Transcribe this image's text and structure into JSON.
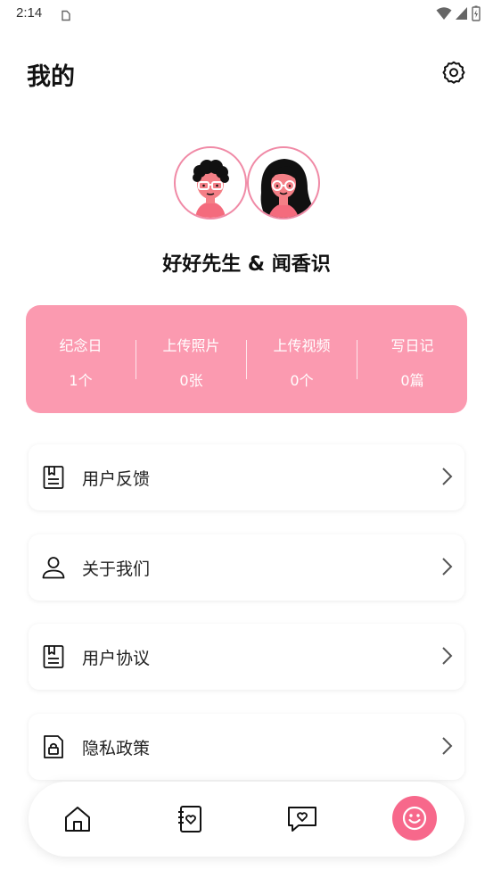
{
  "status_bar": {
    "time": "2:14"
  },
  "header": {
    "title": "我的"
  },
  "profile": {
    "couple_name": "好好先生 & 闻香识"
  },
  "stats": [
    {
      "label": "纪念日",
      "value": "1个"
    },
    {
      "label": "上传照片",
      "value": "0张"
    },
    {
      "label": "上传视频",
      "value": "0个"
    },
    {
      "label": "写日记",
      "value": "0篇"
    }
  ],
  "menu": [
    {
      "label": "用户反馈",
      "icon": "feedback-icon"
    },
    {
      "label": "关于我们",
      "icon": "user-icon"
    },
    {
      "label": "用户协议",
      "icon": "agreement-icon"
    },
    {
      "label": "隐私政策",
      "icon": "privacy-icon"
    }
  ],
  "bottom_nav": [
    {
      "icon": "home-icon"
    },
    {
      "icon": "diary-icon"
    },
    {
      "icon": "message-heart-icon"
    },
    {
      "icon": "smiley-icon",
      "active": true
    }
  ],
  "colors": {
    "card_pink": "#fb9ab0",
    "accent_pink": "#f7688b",
    "avatar_border": "#f08aa6"
  }
}
